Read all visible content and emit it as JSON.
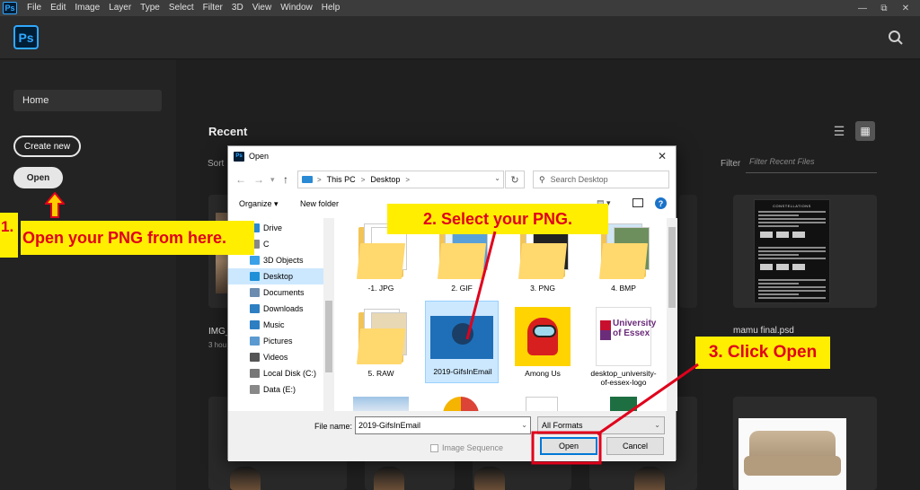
{
  "menubar": {
    "app_badge": "Ps",
    "items": [
      "File",
      "Edit",
      "Image",
      "Layer",
      "Type",
      "Select",
      "Filter",
      "3D",
      "View",
      "Window",
      "Help"
    ],
    "window_controls": [
      "—",
      "⧉",
      "✕"
    ]
  },
  "header": {
    "logo": "Ps",
    "search_icon": "search-icon"
  },
  "sidebar": {
    "home_label": "Home",
    "create_new_label": "Create new",
    "open_label": "Open"
  },
  "main": {
    "recent_title": "Recent",
    "sort_label": "Sort",
    "filter_label": "Filter",
    "filter_placeholder": "Filter Recent Files",
    "files": [
      {
        "name": "IMG_",
        "time": "3 hou"
      },
      {
        "name": "mamu final.psd"
      }
    ],
    "mamu_doc_heading": "CONSTELLATIONS"
  },
  "dialog": {
    "badge": "Ps",
    "title": "Open",
    "close": "✕",
    "address": {
      "root": "This PC",
      "folder": "Desktop",
      "sep": ">"
    },
    "search_placeholder": "Search Desktop",
    "toolbar": {
      "organize": "Organize ▾",
      "new_folder": "New folder",
      "help": "?"
    },
    "nav_items": [
      {
        "label": "Drive",
        "color": "#2a8ad4"
      },
      {
        "label": "C",
        "color": "#888888"
      },
      {
        "label": "3D Objects",
        "color": "#3aa0e8"
      },
      {
        "label": "Desktop",
        "color": "#1e90d8"
      },
      {
        "label": "Documents",
        "color": "#6b8cae"
      },
      {
        "label": "Downloads",
        "color": "#2d7fc2"
      },
      {
        "label": "Music",
        "color": "#2d7fc2"
      },
      {
        "label": "Pictures",
        "color": "#5b9ad0"
      },
      {
        "label": "Videos",
        "color": "#555555"
      },
      {
        "label": "Local Disk (C:)",
        "color": "#777777"
      },
      {
        "label": "Data (E:)",
        "color": "#888888"
      }
    ],
    "files": [
      "-1. JPG",
      "2. GIF",
      "3. PNG",
      "4. BMP",
      "5. RAW",
      "2019-GifsInEmail",
      "Among Us",
      "desktop_university-of-essex-logo"
    ],
    "essex_logo_text": [
      "University",
      "of Essex"
    ],
    "file_name_label": "File name:",
    "file_name_value": "2019-GifsInEmail",
    "formats_value": "All Formats",
    "image_sequence_label": "Image Sequence",
    "open_button": "Open",
    "cancel_button": "Cancel"
  },
  "annotations": {
    "step1_num": "1.",
    "step1_text": "Open your PNG from here.",
    "step2_text": "2. Select your PNG.",
    "step3_text": "3. Click Open",
    "colors": {
      "label_bg": "#ffee00",
      "label_text": "#e0001b",
      "callout": "#e0001b"
    }
  }
}
